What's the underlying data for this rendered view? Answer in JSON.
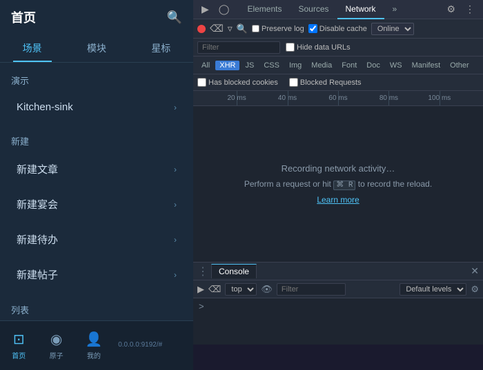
{
  "left": {
    "title": "首页",
    "tabs": [
      {
        "label": "场景",
        "active": true
      },
      {
        "label": "模块",
        "active": false
      },
      {
        "label": "星标",
        "active": false
      }
    ],
    "sections": [
      {
        "label": "演示",
        "items": [
          {
            "label": "Kitchen-sink",
            "hasArrow": true
          }
        ]
      },
      {
        "label": "新建",
        "items": [
          {
            "label": "新建文章",
            "hasArrow": true
          },
          {
            "label": "新建宴会",
            "hasArrow": true
          },
          {
            "label": "新建待办",
            "hasArrow": true
          },
          {
            "label": "新建帖子",
            "hasArrow": true
          }
        ]
      },
      {
        "label": "列表",
        "items": []
      }
    ],
    "bottomTabs": [
      {
        "label": "首页",
        "icon": "⊡",
        "active": true
      },
      {
        "label": "原子",
        "icon": "◉",
        "active": false
      },
      {
        "label": "我的",
        "icon": "👤",
        "active": false
      }
    ],
    "address": "0.0.0.0:9192/#"
  },
  "devtools": {
    "tabs": [
      "Elements",
      "Sources",
      "Network",
      "»"
    ],
    "activeTab": "Network",
    "gearIcon": "⚙",
    "moreIcon": "⋮",
    "toolbar": {
      "recordBtn": "record",
      "clearBtn": "🚫",
      "filterIcon": "▽",
      "searchIcon": "🔍",
      "preserveLog": "Preserve log",
      "disableCache": "Disable cache",
      "online": "Online"
    },
    "filter": {
      "placeholder": "Filter",
      "hideDataUrls": "Hide data URLs"
    },
    "typeFilters": [
      "All",
      "XHR",
      "JS",
      "CSS",
      "Img",
      "Media",
      "Font",
      "Doc",
      "WS",
      "Manifest",
      "Other"
    ],
    "activeTypeFilter": "XHR",
    "blockedBar": {
      "hasBlockedCookies": "Has blocked cookies",
      "blockedRequests": "Blocked Requests"
    },
    "timeline": {
      "marks": [
        "20 ms",
        "40 ms",
        "60 ms",
        "80 ms",
        "100 ms"
      ]
    },
    "mainArea": {
      "recording": "Recording network activity…",
      "perform": "Perform a request or hit",
      "performMid": "⌘ R",
      "performEnd": "to record the reload.",
      "learnMore": "Learn more"
    },
    "console": {
      "tabLabel": "Console",
      "closeBtn": "✕",
      "contextOptions": [
        "top"
      ],
      "filterPlaceholder": "Filter",
      "defaultLevels": "Default levels",
      "prompt": ">"
    }
  }
}
